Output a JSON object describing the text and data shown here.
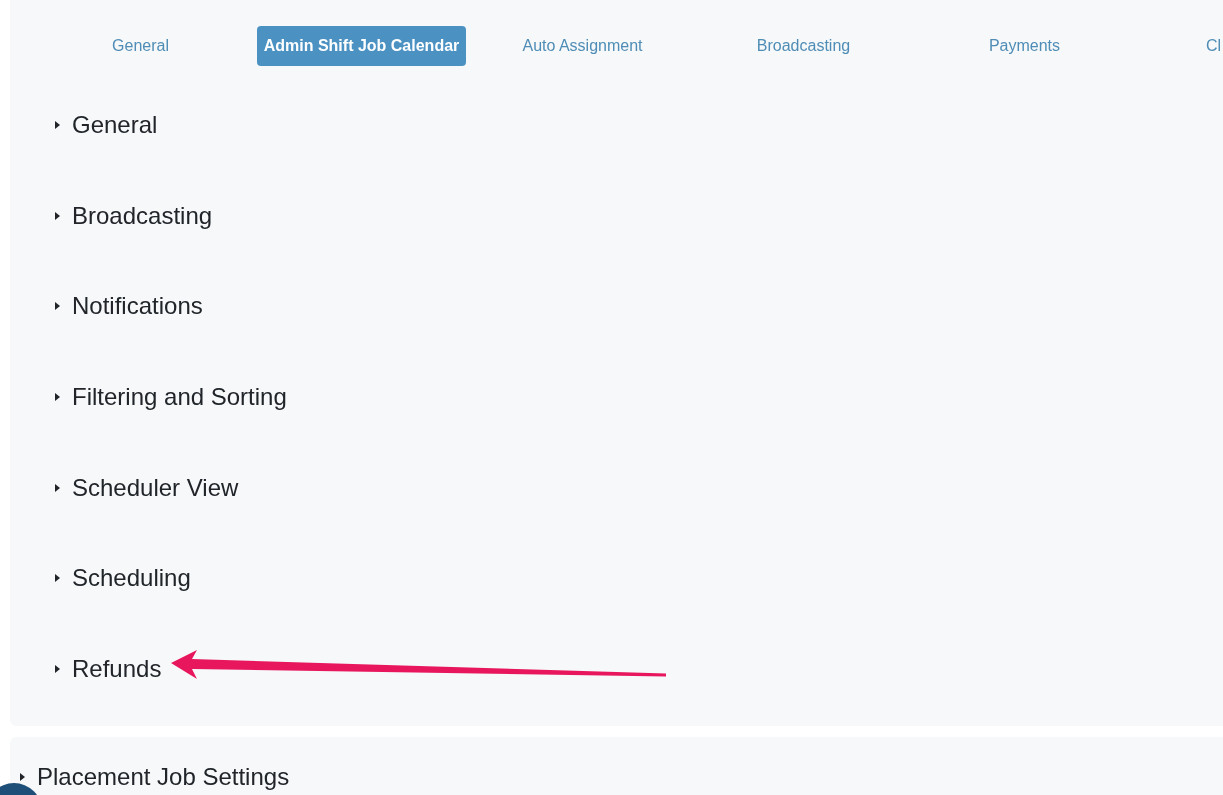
{
  "settings_card": {
    "tabs": [
      {
        "label": "General",
        "selected": false
      },
      {
        "label": "Admin Shift Job Calendar",
        "selected": true
      },
      {
        "label": "Auto Assignment",
        "selected": false
      },
      {
        "label": "Broadcasting",
        "selected": false
      },
      {
        "label": "Payments",
        "selected": false
      },
      {
        "label": "Cl",
        "selected": false
      }
    ],
    "sections": [
      {
        "title": "General",
        "expanded": false,
        "pointed_at_by_arrow": false
      },
      {
        "title": "Broadcasting",
        "expanded": false,
        "pointed_at_by_arrow": false
      },
      {
        "title": "Notifications",
        "expanded": false,
        "pointed_at_by_arrow": false
      },
      {
        "title": "Filtering and Sorting",
        "expanded": false,
        "pointed_at_by_arrow": false
      },
      {
        "title": "Scheduler View",
        "expanded": false,
        "pointed_at_by_arrow": false
      },
      {
        "title": "Scheduling",
        "expanded": false,
        "pointed_at_by_arrow": false
      },
      {
        "title": "Refunds",
        "expanded": false,
        "pointed_at_by_arrow": true
      }
    ]
  },
  "placement_card": {
    "title": "Placement Job Settings",
    "expanded": false
  }
}
